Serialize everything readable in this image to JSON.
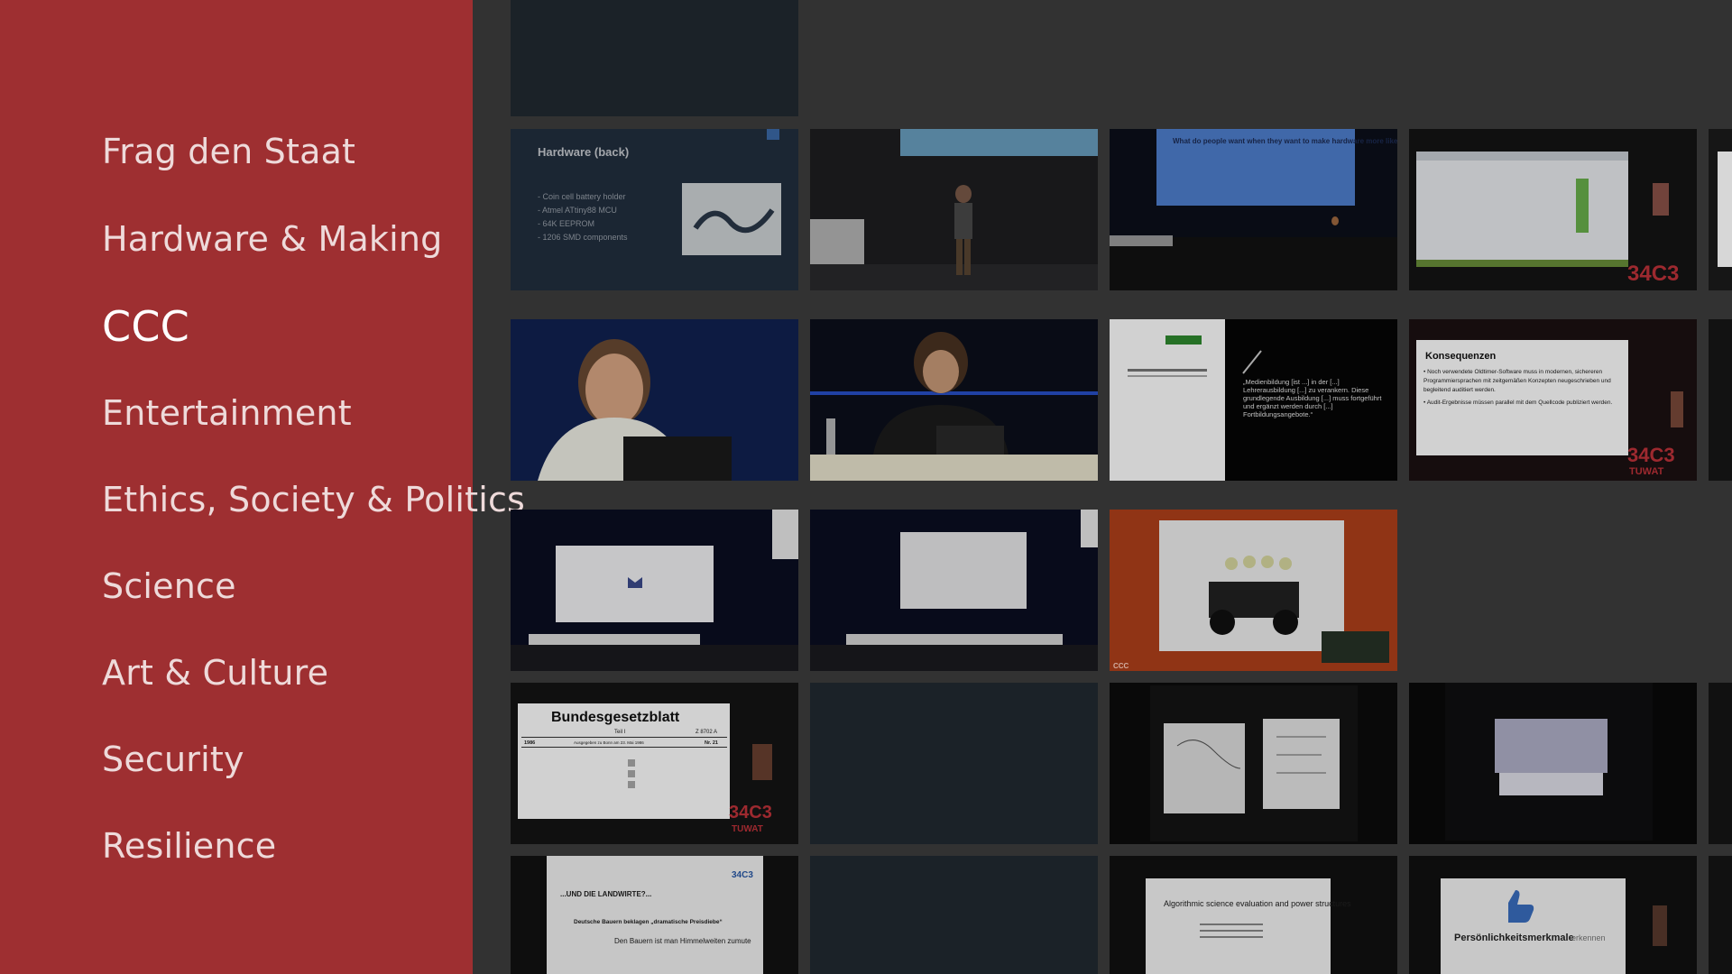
{
  "sidebar": {
    "items": [
      {
        "label": "Frag den Staat"
      },
      {
        "label": "Hardware & Making"
      },
      {
        "label": "CCC",
        "selected": true
      },
      {
        "label": "Entertainment"
      },
      {
        "label": "Ethics, Society & Politics"
      },
      {
        "label": "Science"
      },
      {
        "label": "Art & Culture"
      },
      {
        "label": "Security"
      },
      {
        "label": "Resilience"
      }
    ]
  },
  "thumbnails": {
    "hardware_slide": {
      "title": "Hardware (back)",
      "bullets": [
        "- Coin cell battery holder",
        "- Atmel ATtiny88 MCU",
        "- 64K EEPROM",
        "- 1206 SMD components"
      ]
    },
    "stage_slide_question": "What do people want when they want to make hardware more like software?",
    "quote_slide": {
      "quote": "„Medienbildung [ist ...] in der [...] Lehrerausbildung [...] zu verankern. Diese grundlegende Ausbildung [...] muss fortgeführt und ergänzt werden durch [...] Fortbildungsangebote.“"
    },
    "konsequenzen_slide": {
      "title": "Konsequenzen",
      "bullets": [
        "• Noch verwendete Oldtimer-Software muss in modernen, sichereren Programmiersprachen mit zeitgemäßen Konzepten neugeschrieben und begleitend auditiert werden.",
        "• Audit-Ergebnisse müssen parallel mit dem Quellcode publiziert werden."
      ]
    },
    "bgbl_slide": {
      "title": "Bundesgesetzblatt",
      "part": "Teil I",
      "number": "Z 8702 A",
      "year": "1986",
      "date_line": "Ausgegeben zu Bonn am 23. Mai 1986",
      "issue": "Nr. 21"
    },
    "landwirte_slide": {
      "heading": "...UND DIE LANDWIRTE?...",
      "headline": "Deutsche Bauern beklagen „dramatische Preisdiebe“",
      "subline": "Den Bauern ist man Himmelweiten zumute"
    },
    "algorithmic_slide": {
      "title": "Algorithmic science evaluation and power structures"
    },
    "personality_slide": {
      "title": "Persönlichkeitsmerkmale",
      "title_suffix": "erkennen"
    },
    "event_badge": "34C3",
    "event_badge_sub": "TUWAT",
    "ccc_mark": "CCC"
  }
}
